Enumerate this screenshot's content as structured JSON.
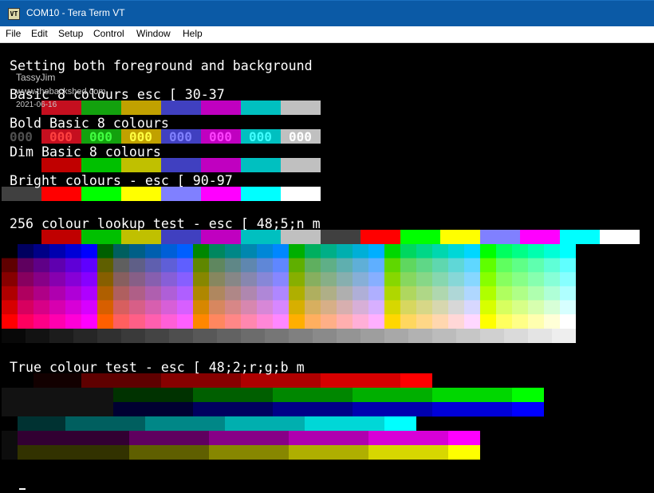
{
  "window": {
    "title": "COM10 - Tera Term VT",
    "icon": "terminal-app-icon",
    "icon_glyph": "VT"
  },
  "menu": [
    "File",
    "Edit",
    "Setup",
    "Control",
    "Window",
    "Help"
  ],
  "terminal": {
    "fg": "#ffffff",
    "bg": "#000000",
    "lines": [
      "Setting both foreground and background",
      "Basic 8 colours esc [ 30-37",
      "Bold Basic 8 colours",
      "Dim Basic 8 colours",
      "Bright colours - esc [ 90-97",
      "256 colour lookup test - esc [ 48;5;n m",
      "True colour test - esc [ 48;2;r;g;b m"
    ],
    "bold_sample_text": "000",
    "basic_colours": [
      "#000000",
      "#c50f1f",
      "#13a10e",
      "#c1a100",
      "#4040c0",
      "#c000c0",
      "#00c0c0",
      "#c0c0c0"
    ],
    "bold_fg_colours": [
      "#505050",
      "#ff4040",
      "#40ff40",
      "#ffff40",
      "#8080ff",
      "#ff40ff",
      "#40ffff",
      "#ffffff"
    ],
    "dim_colours": [
      "#000000",
      "#c00000",
      "#00c000",
      "#c0c000",
      "#4040c0",
      "#c000c0",
      "#00c0c0",
      "#c0c0c0"
    ],
    "bright_colours": [
      "#404040",
      "#ff0000",
      "#00ff00",
      "#ffff00",
      "#8080ff",
      "#ff00ff",
      "#00ffff",
      "#ffffff"
    ],
    "lookup_first16": [
      "#000000",
      "#c00000",
      "#00c000",
      "#c0c000",
      "#4040c0",
      "#c000c0",
      "#00c0c0",
      "#c0c0c0",
      "#404040",
      "#ff0000",
      "#00ff00",
      "#ffff00",
      "#8080ff",
      "#ff00ff",
      "#00ffff",
      "#ffffff"
    ],
    "true_colour_rows": [
      {
        "channel": "red",
        "colour": "#ff0000"
      },
      {
        "channel": "green",
        "colour": "#00ff00"
      },
      {
        "channel": "blue",
        "colour": "#0000ff"
      },
      {
        "channel": "cyan",
        "colour": "#00ffff"
      },
      {
        "channel": "magenta",
        "colour": "#ff00ff"
      },
      {
        "channel": "yellow",
        "colour": "#ffff00"
      }
    ]
  },
  "watermark": {
    "name": "TassyJim",
    "site": "www.thebackshed.com",
    "date": "2021-06-16"
  }
}
